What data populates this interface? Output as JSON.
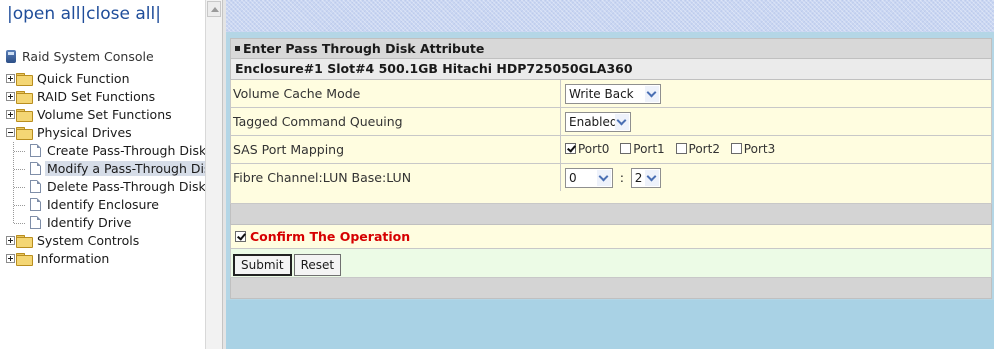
{
  "nav": {
    "open_all": "open all",
    "close_all": "close all",
    "sep": "|",
    "root": "Raid System Console",
    "items": [
      {
        "label": "Quick Function",
        "expanded": false
      },
      {
        "label": "RAID Set Functions",
        "expanded": false
      },
      {
        "label": "Volume Set Functions",
        "expanded": false
      },
      {
        "label": "Physical Drives",
        "expanded": true,
        "children": [
          "Create Pass-Through Disk",
          "Modify a Pass-Through Disk",
          "Delete Pass-Through Disk",
          "Identify Enclosure",
          "Identify Drive"
        ]
      },
      {
        "label": "System Controls",
        "expanded": false
      },
      {
        "label": "Information",
        "expanded": false
      }
    ],
    "selected": "Modify a Pass-Through Disk"
  },
  "form": {
    "section_title": "Enter Pass Through Disk Attribute",
    "disk_info": "Enclosure#1 Slot#4 500.1GB Hitachi HDP725050GLA360",
    "fields": {
      "cache_mode": {
        "label": "Volume Cache Mode",
        "value": "Write Back"
      },
      "tcq": {
        "label": "Tagged Command Queuing",
        "value": "Enabled"
      },
      "sas_port": {
        "label": "SAS Port Mapping",
        "ports": [
          {
            "label": "Port0",
            "checked": true
          },
          {
            "label": "Port1",
            "checked": false
          },
          {
            "label": "Port2",
            "checked": false
          },
          {
            "label": "Port3",
            "checked": false
          }
        ]
      },
      "lun": {
        "label": "Fibre Channel:LUN Base:LUN",
        "base": "0",
        "sep": ":",
        "lun": "2"
      }
    },
    "confirm": {
      "label": "Confirm The Operation",
      "checked": true
    },
    "submit": "Submit",
    "reset": "Reset"
  },
  "colors": {
    "confirm_text": "#d60000",
    "field_row_bg": "#fffde0",
    "action_row_bg": "#ecfbe6",
    "frame_bg": "#b4d6e6",
    "link": "#1f4d9a"
  }
}
